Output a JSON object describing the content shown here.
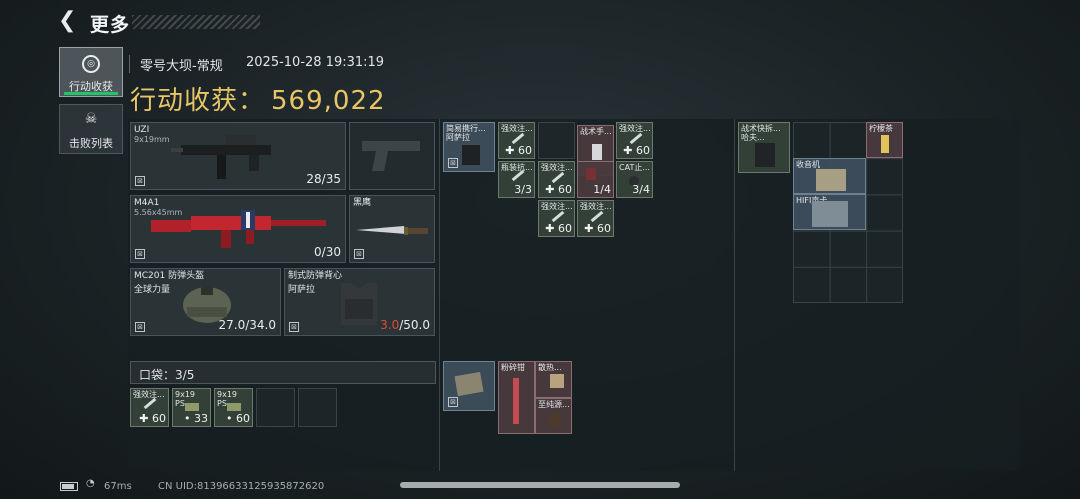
{
  "header": {
    "back_icon": "chevron-left-icon",
    "title": "更多"
  },
  "tabs": [
    {
      "label": "行动收获",
      "icon": "target-icon",
      "active": true
    },
    {
      "label": "击败列表",
      "icon": "skull-icon",
      "active": false
    }
  ],
  "summary": {
    "map": "零号大坝-常规",
    "datetime": "2025-10-28 19:31:19",
    "income_label": "行动收获：",
    "income_value": "569,022"
  },
  "equipment": {
    "primary": {
      "name": "UZI",
      "caliber": "9x19mm",
      "ammo": "28/35"
    },
    "sidearm": {
      "name": "",
      "ammo": ""
    },
    "secondary": {
      "name": "M4A1",
      "caliber": "5.56x45mm",
      "ammo": "0/30"
    },
    "melee": {
      "name": "黑鹰"
    },
    "helmet": {
      "name": "MC201 防弹头盔",
      "sub": "全球力量",
      "durability": "27.0/34.0"
    },
    "armor": {
      "name": "制式防弹背心",
      "sub": "阿萨拉",
      "durability_current": "3.0",
      "durability_max": "/50.0"
    }
  },
  "pocket": {
    "label": "口袋：",
    "count": "3/5",
    "items": [
      {
        "name": "强效注...",
        "value": "✚ 60"
      },
      {
        "name": "9x19 PS...",
        "value": "• 33"
      },
      {
        "name": "9x19 PS...",
        "value": "• 60"
      }
    ]
  },
  "backpack": {
    "items": [
      {
        "name": "简易携行... 阿萨拉",
        "value": ""
      },
      {
        "name": "强效注...",
        "value": "✚ 60"
      },
      {
        "name": "",
        "value": ""
      },
      {
        "name": "战术手...",
        "value": ""
      },
      {
        "name": "强效注...",
        "value": "✚ 60"
      },
      {
        "name": "瓶装抗...",
        "value": "3/3"
      },
      {
        "name": "强效注...",
        "value": "✚ 60"
      },
      {
        "name": "",
        "value": "1/4"
      },
      {
        "name": "CAT止...",
        "value": "3/4"
      },
      {
        "name": "强效注...",
        "value": "✚ 60"
      },
      {
        "name": "强效注...",
        "value": "✚ 60"
      }
    ],
    "safe_box": [
      {
        "name": "",
        "value": ""
      },
      {
        "name": "粉碎钳",
        "value": ""
      },
      {
        "name": "散热...",
        "value": ""
      },
      {
        "name": "至纯源...",
        "value": ""
      }
    ]
  },
  "rig": {
    "items": [
      {
        "name": "战术快拆... 哈夫...",
        "value": ""
      },
      {
        "name": "柠檬茶",
        "value": ""
      },
      {
        "name": "收音机",
        "value": ""
      },
      {
        "name": "HIFI声卡",
        "value": ""
      }
    ]
  },
  "status": {
    "ping": "67ms",
    "uid": "CN UID:8139663312593587262​0"
  }
}
